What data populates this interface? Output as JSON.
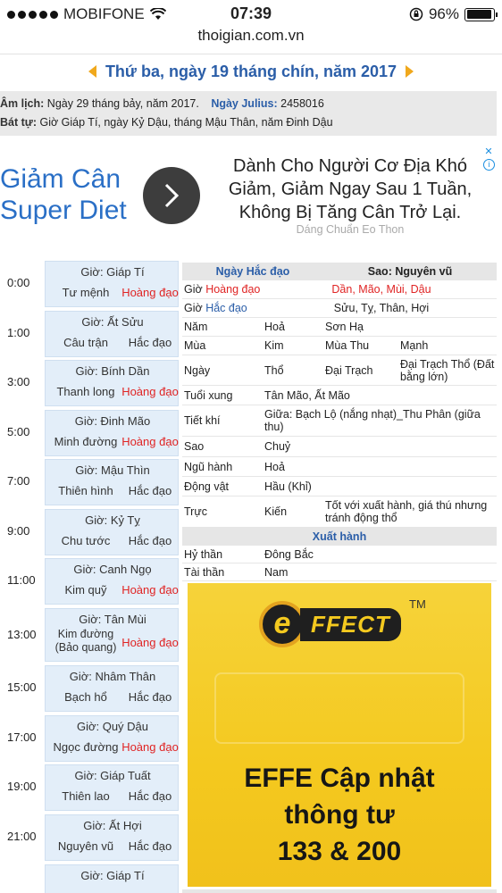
{
  "status": {
    "carrier": "MOBIFONE",
    "time": "07:39",
    "battery": "96%",
    "battery_level": 0.96,
    "url": "thoigian.com.vn"
  },
  "date_title": "Thứ ba, ngày 19 tháng chín, năm 2017",
  "lunar": {
    "label": "Âm lịch:",
    "value": "Ngày 29 tháng bảy, năm 2017.",
    "julius_label": "Ngày Julius:",
    "julius_value": "2458016",
    "battu_label": "Bát tự:",
    "battu_value": "Giờ Giáp Tí, ngày Kỷ Dậu, tháng Mậu Thân, năm Đinh Dậu"
  },
  "ad_top": {
    "left_line1": "Giảm Cân",
    "left_line2": "Super Diet",
    "right_line1": "Dành Cho Người Cơ Địa Khó",
    "right_line2": "Giảm, Giảm Ngay Sau 1 Tuần,",
    "right_line3": "Không Bị Tăng Cân Trở Lại.",
    "sub": "Dáng Chuẩn Eo Thon"
  },
  "hours": [
    {
      "time": "0:00",
      "gio": "Giờ: Giáp Tí",
      "than": "Tư mệnh",
      "dao": "Hoàng đạo"
    },
    {
      "time": "1:00",
      "gio": "Giờ: Ất Sửu",
      "than": "Câu trận",
      "dao": "Hắc đạo"
    },
    {
      "time": "3:00",
      "gio": "Giờ: Bính Dần",
      "than": "Thanh long",
      "dao": "Hoàng đạo"
    },
    {
      "time": "5:00",
      "gio": "Giờ: Đinh Mão",
      "than": "Minh đường",
      "dao": "Hoàng đạo"
    },
    {
      "time": "7:00",
      "gio": "Giờ: Mậu Thìn",
      "than": "Thiên hình",
      "dao": "Hắc đạo"
    },
    {
      "time": "9:00",
      "gio": "Giờ: Kỷ Tỵ",
      "than": "Chu tước",
      "dao": "Hắc đạo"
    },
    {
      "time": "11:00",
      "gio": "Giờ: Canh Ngọ",
      "than": "Kim quỹ",
      "dao": "Hoàng đạo"
    },
    {
      "time": "13:00",
      "gio": "Giờ: Tân Mùi",
      "than": "Kim đường (Bảo quang)",
      "dao": "Hoàng đạo"
    },
    {
      "time": "15:00",
      "gio": "Giờ: Nhâm Thân",
      "than": "Bạch hổ",
      "dao": "Hắc đạo"
    },
    {
      "time": "17:00",
      "gio": "Giờ: Quý Dậu",
      "than": "Ngọc đường",
      "dao": "Hoàng đạo"
    },
    {
      "time": "19:00",
      "gio": "Giờ: Giáp Tuất",
      "than": "Thiên lao",
      "dao": "Hắc đạo"
    },
    {
      "time": "21:00",
      "gio": "Giờ: Ất Hợi",
      "than": "Nguyên vũ",
      "dao": "Hắc đạo"
    },
    {
      "time": "",
      "gio": "Giờ: Giáp Tí",
      "than": "",
      "dao": ""
    }
  ],
  "info": {
    "header_left": "Ngày Hắc đạo",
    "header_right": "Sao: Nguyên vũ",
    "gio_hoang_prefix": "Giờ",
    "gio_hoang_word": "Hoàng đạo",
    "gio_hoang_value": "Dần, Mão, Mùi, Dậu",
    "gio_hac_prefix": "Giờ",
    "gio_hac_word": "Hắc đạo",
    "gio_hac_value": "Sửu, Tỵ, Thân, Hợi",
    "nam": [
      "Năm",
      "Hoả",
      "Sơn Hạ",
      ""
    ],
    "mua": [
      "Mùa",
      "Kim",
      "Mùa Thu",
      "Mạnh"
    ],
    "ngay": [
      "Ngày",
      "Thổ",
      "Đại Trạch",
      "Đại Trạch Thổ (Đất bằng lớn)"
    ],
    "tuoi_xung": [
      "Tuổi xung",
      "Tân Mão, Ất Mão"
    ],
    "tiet_khi": [
      "Tiết khí",
      "Giữa: Bạch Lộ (nắng nhạt)_Thu Phân (giữa thu)"
    ],
    "sao": [
      "Sao",
      "Chuỷ"
    ],
    "ngu_hanh": [
      "Ngũ hành",
      "Hoả"
    ],
    "dong_vat": [
      "Động vật",
      "Hầu (Khỉ)"
    ],
    "truc": [
      "Trực",
      "Kiến",
      "Tốt với xuất hành, giá thú nhưng tránh động thổ"
    ],
    "xuat_hanh": "Xuất hành",
    "hy_than": [
      "Hỷ thần",
      "Đông Bắc"
    ],
    "tai_than": [
      "Tài thần",
      "Nam"
    ]
  },
  "effect_ad": {
    "logo_e": "e",
    "logo_text": "FFECT",
    "tm": "TM",
    "line1": "EFFE Cập nhật",
    "line2": "thông tư",
    "line3": "133 & 200"
  },
  "colors": {
    "blue": "#2b5ea8",
    "red": "#e02424",
    "hour_box": "#e3eef9",
    "ad_yellow": "#f4c91f"
  }
}
